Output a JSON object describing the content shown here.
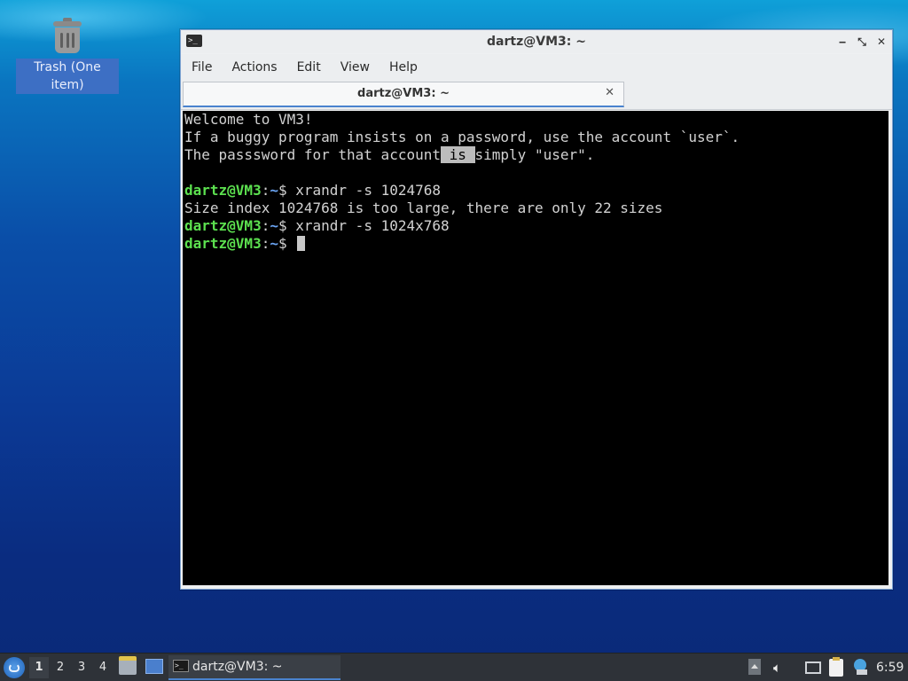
{
  "desktop": {
    "icons": [
      {
        "label": "Trash (One item)",
        "icon": "trash-icon"
      }
    ]
  },
  "window": {
    "title": "dartz@VM3: ~",
    "icon": "terminal-icon",
    "menu": [
      "File",
      "Actions",
      "Edit",
      "View",
      "Help"
    ],
    "tab": {
      "label": "dartz@VM3: ~",
      "close": "✕"
    },
    "controls": {
      "minimize": "‒",
      "maximize": "⤡",
      "close": "✕"
    }
  },
  "terminal": {
    "lines": [
      {
        "type": "text",
        "text": "Welcome to VM3!"
      },
      {
        "type": "text",
        "text": "If a buggy program insists on a password, use the account `user`."
      },
      {
        "type": "text-highlight",
        "before": "The passsword for that account",
        "highlight": " is ",
        "after": "simply \"user\"."
      },
      {
        "type": "blank"
      },
      {
        "type": "prompt",
        "user": "dartz@VM3",
        "sep": ":",
        "dir": "~",
        "symbol": "$ ",
        "cmd": "xrandr -s 1024768"
      },
      {
        "type": "text",
        "text": "Size index 1024768 is too large, there are only 22 sizes"
      },
      {
        "type": "prompt",
        "user": "dartz@VM3",
        "sep": ":",
        "dir": "~",
        "symbol": "$ ",
        "cmd": "xrandr -s 1024x768"
      },
      {
        "type": "prompt-cursor",
        "user": "dartz@VM3",
        "sep": ":",
        "dir": "~",
        "symbol": "$ ",
        "cmd": ""
      }
    ]
  },
  "taskbar": {
    "workspaces": [
      "1",
      "2",
      "3",
      "4"
    ],
    "active_workspace": "1",
    "task": {
      "label": "dartz@VM3: ~",
      "icon": "terminal-icon"
    },
    "clock": "6:59",
    "tray_icons": [
      "show-hidden-icon",
      "volume-icon",
      "network-icon",
      "clipboard-icon",
      "updates-icon"
    ]
  },
  "colors": {
    "prompt_user": "#5ce04f",
    "prompt_dir": "#6aa4f2",
    "terminal_bg": "#000000",
    "accent": "#4a83cf"
  }
}
